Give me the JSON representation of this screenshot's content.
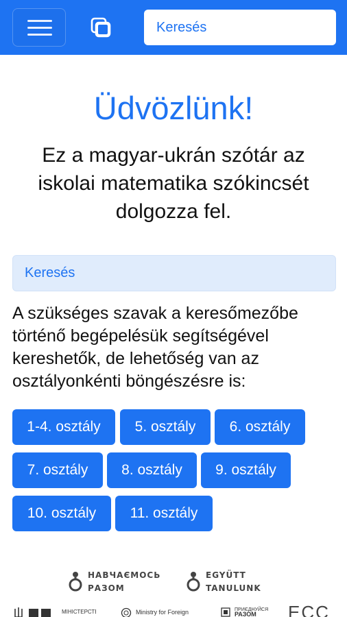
{
  "header": {
    "menu_icon": "hamburger-menu-icon",
    "copy_icon": "copy-overlap-icon",
    "search_placeholder": "Keresés",
    "background_color": "#1e73f2"
  },
  "main": {
    "welcome_title": "Üdvözlünk!",
    "intro_text": "Ez a magyar-ukrán szótár az iskolai matematika szókincsét dolgozza fel.",
    "search_panel_label": "Keresés",
    "info_text": "A szükséges szavak a keresőmezőbe történő begépelésük segítségével kereshetők, de lehetőség van az osztályonkénti böngészésre is:",
    "accent_color": "#1e73f2",
    "panel_color": "#e0ecfc"
  },
  "grades": [
    "1-4. osztály",
    "5. osztály",
    "6. osztály",
    "7. osztály",
    "8. osztály",
    "9. osztály",
    "10. osztály",
    "11. osztály"
  ],
  "footer": {
    "logo_ua_line1": "НАВЧАЄМОСЬ",
    "logo_ua_line2": "РАЗОМ",
    "logo_hu_line1": "EGYÜTT",
    "logo_hu_line2": "TANULUNK",
    "partner_ministry_ua": "МІНІСТЕРСТВО",
    "partner_ministry_foreign": "Ministry for Foreign",
    "partner_together": "ПРИЄДНУЙСЯ",
    "partner_together_2": "РАЗОМ",
    "partner_ecc": "ECC"
  }
}
